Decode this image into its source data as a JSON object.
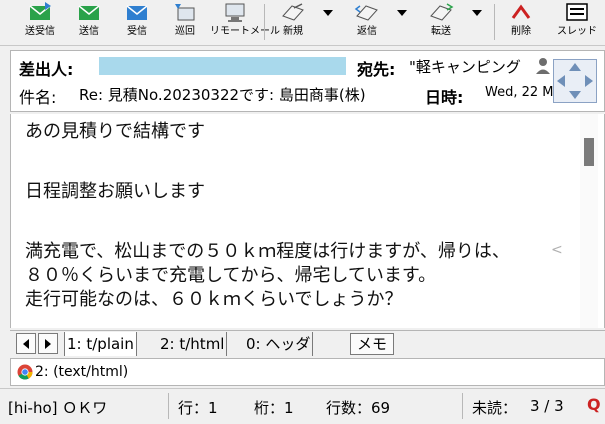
{
  "toolbar": {
    "send_receive": "送受信",
    "send": "送信",
    "receive": "受信",
    "patrol": "巡回",
    "remote_mail": "リモートメール",
    "new": "新規",
    "reply": "返信",
    "forward": "転送",
    "delete": "削除",
    "thread": "スレッド"
  },
  "header": {
    "sender_label": "差出人:",
    "sender_value": "",
    "to_label": "宛先:",
    "to_value": "\"軽キャンピング",
    "subject_label": "件名:",
    "subject_value": "Re: 見積No.20230322です: 島田商事(株)",
    "date_label": "日時:",
    "date_value": "Wed, 22 M"
  },
  "body": {
    "lines": [
      "あの見積りで結構です",
      "日程調整お願いします",
      "満充電で、松山までの５０ｋｍ程度は行けますが、帰りは、",
      "８０％くらいまで充電してから、帰宅しています。",
      "走行可能なのは、６０ｋｍくらいでしょうか？"
    ],
    "wrap_mark": "<"
  },
  "tabs": [
    "1: t/plain",
    "2: t/html",
    "0: ヘッダ",
    "メモ"
  ],
  "attachment": {
    "label": "2: (text/html)"
  },
  "status": {
    "account": "[hi-ho] ＯＫワ",
    "row": "行：1",
    "column": "桁：1",
    "line_count": "行数：69",
    "unread_label": "未読：",
    "unread_value": "3 / 3"
  },
  "colors": {
    "sender_highlight": "#a9d9ec",
    "accent_red": "#cc2222",
    "toolbar_green": "#2aa24a",
    "toolbar_blue": "#2f7fd0"
  }
}
